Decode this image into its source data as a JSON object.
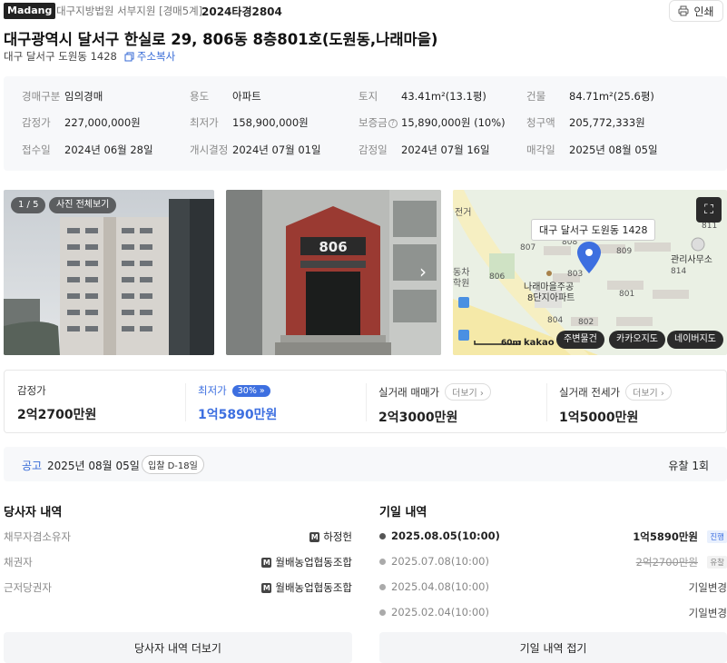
{
  "header": {
    "logo": "Madang",
    "court": "대구지방법원 서부지원 [경매5계]",
    "case_no": "2024타경2804",
    "print_label": "인쇄"
  },
  "title": "대구광역시 달서구 한실로 29, 806동 8층801호(도원동,나래마을)",
  "sub_address": "대구 달서구 도원동 1428",
  "copy_address_label": "주소복사",
  "info": {
    "auction_type_k": "경매구분",
    "auction_type_v": "임의경매",
    "use_k": "용도",
    "use_v": "아파트",
    "land_k": "토지",
    "land_v": "43.41m²(13.1평)",
    "building_k": "건물",
    "building_v": "84.71m²(25.6평)",
    "appraisal_k": "감정가",
    "appraisal_v": "227,000,000원",
    "minimum_k": "최저가",
    "minimum_v": "158,900,000원",
    "deposit_k": "보증금",
    "deposit_v": "15,890,000원 (10%)",
    "claim_k": "청구액",
    "claim_v": "205,772,333원",
    "received_k": "접수일",
    "received_v": "2024년 06월 28일",
    "start_k": "개시결정",
    "start_v": "2024년 07월 01일",
    "appraisal_date_k": "감정일",
    "appraisal_date_v": "2024년 07월 16일",
    "sale_date_k": "매각일",
    "sale_date_v": "2025년 08월 05일"
  },
  "gallery": {
    "counter": "1 / 5",
    "view_all": "사진 전체보기",
    "building_sign": "806"
  },
  "map": {
    "address_label": "대구 달서구 도원동 1428",
    "scale": "60m",
    "provider": "kakao",
    "btn_nearby": "주변물건",
    "btn_kakao": "카카오지도",
    "btn_naver": "네이버지도",
    "labels": {
      "l807": "807",
      "l806": "806",
      "l803": "803",
      "l809": "809",
      "l801": "801",
      "l804": "804",
      "l802": "802",
      "l811": "811",
      "l814": "814",
      "l808": "808",
      "l_office": "관리사무소",
      "l_complex1": "나래마을주공",
      "l_complex2": "8단지아파트",
      "l_left1": "전거",
      "l_left2": "동차",
      "l_left3": "학원"
    }
  },
  "prices": {
    "appraisal_label": "감정가",
    "appraisal_value": "2억2700만원",
    "minimum_label": "최저가",
    "minimum_rate": "30%",
    "minimum_value": "1억5890만원",
    "sale_label": "실거래 매매가",
    "sale_more": "더보기",
    "sale_value": "2억3000만원",
    "rent_label": "실거래 전세가",
    "rent_more": "더보기",
    "rent_value": "1억5000만원"
  },
  "notice": {
    "label": "공고",
    "date": "2025년 08월 05일",
    "dday": "입찰 D-18일",
    "fail_count": "유찰 1회"
  },
  "parties": {
    "title": "당사자 내역",
    "rows": [
      {
        "role": "채무자겸소유자",
        "name": "하정헌"
      },
      {
        "role": "채권자",
        "name": "월배농업협동조합"
      },
      {
        "role": "근저당권자",
        "name": "월배농업협동조합"
      }
    ],
    "more_label": "당사자 내역 더보기"
  },
  "history": {
    "title": "기일 내역",
    "rows": [
      {
        "date": "2025.08.05(10:00)",
        "amount": "1억5890만원",
        "tag": "진행"
      },
      {
        "date": "2025.07.08(10:00)",
        "amount": "2억2700만원",
        "tag": "유찰"
      },
      {
        "date": "2025.04.08(10:00)",
        "amount": "기일변경"
      },
      {
        "date": "2025.02.04(10:00)",
        "amount": "기일변경"
      }
    ],
    "fold_label": "기일 내역 접기"
  },
  "colors": {
    "accent": "#3d6fe0",
    "link": "#3469d6",
    "map_pin": "#3d6fe0"
  }
}
